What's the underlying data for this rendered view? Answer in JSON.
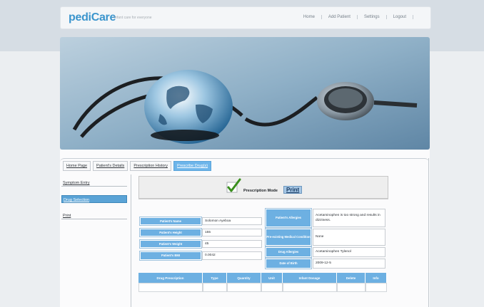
{
  "header": {
    "logo": "pediCare",
    "tagline": "infant care for everyone",
    "nav": [
      "Home",
      "Add Patient",
      "Settings",
      "Logout"
    ]
  },
  "hero": {
    "icon": "globe-stethoscope-image"
  },
  "tabs": [
    "Home Page",
    "Patient's Details",
    "Prescription History",
    "Prescribe Drug(s)"
  ],
  "active_tab": "Prescribe Drug(s)",
  "sidebar": [
    "Symptom Entry",
    "Drug Selection",
    "Print"
  ],
  "active_sidebar": "Drug Selection",
  "mode": {
    "label": "Prescription Mode",
    "print": "Print"
  },
  "patient": {
    "name_label": "Patient's Name",
    "name": "Solomon Ayeboa",
    "height_label": "Patient's Height",
    "height": "155",
    "weight_label": "Patient's Weight",
    "weight": "45",
    "bmi_label": "Patient's BMI",
    "bmi": "0.0042"
  },
  "medical": {
    "allergies_label": "Patient's Allergies",
    "allergies": "Acetaminophen is too strong and results in dizziness.",
    "conditions_label": "Pre-existing Medical Condition",
    "conditions": "None",
    "drug_allergies_label": "Drug Allergies",
    "drug_allergies": "Acetaminophen Tylenol",
    "dob_label": "Date of Birth",
    "dob": "2009-12-5"
  },
  "table": {
    "headers": [
      "Drug Prescription",
      "Type",
      "Quantity",
      "Unit",
      "Infant Dosage",
      "Delete",
      "Info"
    ]
  },
  "colors": {
    "accent": "#3b95cd",
    "label_bg": "#6db0e2",
    "check": "#3a8f1e"
  }
}
